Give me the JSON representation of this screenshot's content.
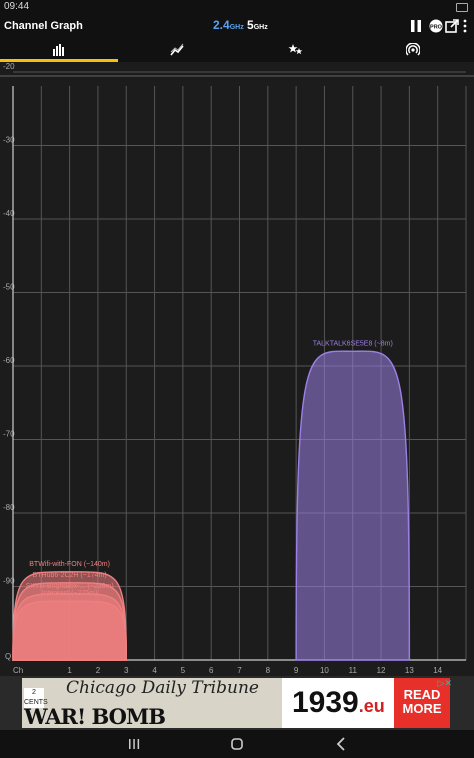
{
  "status": {
    "time": "09:44"
  },
  "app": {
    "title": "Channel Graph",
    "band_24": "2.4",
    "band_24_unit": "GHz",
    "band_5": "5",
    "band_5_unit": "GHz"
  },
  "actions": [
    "pause-icon",
    "pro-badge-icon",
    "share-icon",
    "more-vert-icon"
  ],
  "tabs": [
    "channel-graph-tab",
    "time-graph-tab",
    "channel-rating-tab",
    "access-points-tab"
  ],
  "ad": {
    "paper": "Chicago Daily Tribune",
    "cents": "2 CENTS",
    "headline": "WAR! BOMB WARSAW!",
    "year": "1939",
    "tld": ".eu",
    "cta": "READ MORE",
    "colors": {
      "cta": "#e8302a"
    }
  },
  "chart_data": {
    "type": "area",
    "x_label_prefix": "Ch",
    "xlim": [
      -1,
      15
    ],
    "ylim": [
      -100,
      -20
    ],
    "y_ticks": [
      -20,
      -30,
      -40,
      -50,
      -60,
      -70,
      -80,
      -90
    ],
    "x_ticks": [
      1,
      2,
      3,
      4,
      5,
      6,
      7,
      8,
      9,
      10,
      11,
      12,
      13,
      14
    ],
    "grid": true,
    "series": [
      {
        "name": "BTWifi-with-FON (~140m)",
        "center": 1,
        "from": -1,
        "to": 3,
        "peak": -88,
        "color": "#f08080"
      },
      {
        "name": "BTHub6-2C2H (~174m)",
        "center": 1,
        "from": -1,
        "to": 3,
        "peak": -89.5,
        "color": "#f08080"
      },
      {
        "name": "SKYR-BrightBox-... (~236m)",
        "center": 1,
        "from": -1,
        "to": 3,
        "peak": -91,
        "color": "#f08080"
      },
      {
        "name": "Intereast (~275m)",
        "center": 1,
        "from": -1,
        "to": 3,
        "peak": -92,
        "color": "#f08080"
      },
      {
        "name": "TALKTALK6SE5E8 (~8m)",
        "center": 11,
        "from": 9,
        "to": 13,
        "peak": -58,
        "color": "#9b7fe6"
      }
    ]
  }
}
